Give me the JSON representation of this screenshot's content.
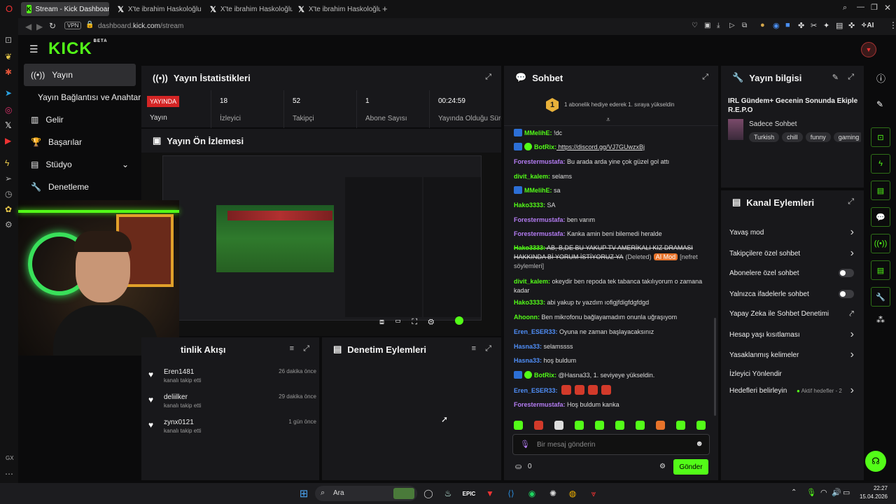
{
  "browser": {
    "tabs": [
      {
        "label": "Stream - Kick Dashboard",
        "active": true
      },
      {
        "label": "X'te ibrahim Haskoloğlu: \"",
        "active": false
      },
      {
        "label": "X'te ibrahim Haskoloğlu: \"",
        "active": false
      },
      {
        "label": "X'te ibrahim Haskoloğlu: \"",
        "active": false
      }
    ],
    "new_tab": "+",
    "vpn": "VPN",
    "url_host": "dashboard.",
    "url_bold": "kick.com",
    "url_path": "/stream",
    "ai_label": "AI",
    "sidebar_label": "GX"
  },
  "kick": {
    "logo": "KICK",
    "beta": "BETA",
    "nav": [
      {
        "label": "Yayın",
        "icon": "broadcast-icon",
        "active": true
      },
      {
        "label": "Yayın Bağlantısı ve Anahtarı",
        "icon": "",
        "active": false
      },
      {
        "label": "Gelir",
        "icon": "chart-icon",
        "active": false
      },
      {
        "label": "Başarılar",
        "icon": "trophy-icon",
        "active": false
      },
      {
        "label": "Stüdyo",
        "icon": "studio-icon",
        "active": false
      },
      {
        "label": "Denetleme",
        "icon": "wrench-icon",
        "active": false
      }
    ]
  },
  "stats": {
    "title": "Yayın İstatistikleri",
    "status_badge": "YAYINDA",
    "status_label": "Yayın",
    "items": [
      {
        "value": "18",
        "label": "İzleyici"
      },
      {
        "value": "52",
        "label": "Takipçi"
      },
      {
        "value": "1",
        "label": "Abone Sayısı"
      },
      {
        "value": "00:24:59",
        "label": "Yayında Olduğu Süre"
      }
    ]
  },
  "preview": {
    "title": "Yayın Ön İzlemesi"
  },
  "activity": {
    "title": "tinlik Akışı",
    "events": [
      {
        "name": "Eren1481",
        "sub": "kanalı takip etti",
        "time": "26 dakika önce"
      },
      {
        "name": "deliilker",
        "sub": "kanalı takip etti",
        "time": "29 dakika önce"
      },
      {
        "name": "zynx0121",
        "sub": "kanalı takip etti",
        "time": "1 gün önce"
      }
    ]
  },
  "modactions": {
    "title": "Denetim Eylemleri"
  },
  "chat": {
    "title": "Sohbet",
    "pinned_rank": "1",
    "pinned": "1 abonelik hediye ederek 1. sıraya yükseldin",
    "messages": [
      {
        "user": "MMelihE:",
        "color": "bot",
        "text": " !dc"
      },
      {
        "user": "BotRix:",
        "color": "bot",
        "text": " https://discord.gg/VJ7GUwzxBj"
      },
      {
        "user": "Forestermustafa:",
        "color": "purple",
        "text": " Bu arada arda yine çok güzel gol attı"
      },
      {
        "user": "divit_kalem:",
        "color": "green",
        "text": " selams"
      },
      {
        "user": "MMelihE:",
        "color": "bot",
        "text": " sa"
      },
      {
        "user": "Hako3333:",
        "color": "green",
        "text": " SA"
      },
      {
        "user": "Forestermustafa:",
        "color": "purple",
        "text": " ben varım"
      },
      {
        "user": "Forestermustafa:",
        "color": "purple",
        "text": " Kanka amin beni bilemedi heralde"
      },
      {
        "user": "Hako3333:",
        "color": "green",
        "text": " AB, B,DE BU YAKUP TV AMERİKALI KIZ DRAMASI HAKKINDA Bİ YORUM İSTİYORUZ YA"
      },
      {
        "user": "divit_kalem:",
        "color": "green",
        "text": " okeydir ben repoda tek tabanca takılıyorum o zamana kadar"
      },
      {
        "user": "Hako3333:",
        "color": "green",
        "text": " abi yakup tv yazdım ıofigjfdigfdgfdgd"
      },
      {
        "user": "Ahoonn:",
        "color": "green",
        "text": " Ben mikrofonu bağlayamadım onunla uğraşıyom"
      },
      {
        "user": "Eren_ESER33:",
        "color": "blue",
        "text": " Oyuna ne zaman başlayacaksınız"
      },
      {
        "user": "Hasna33:",
        "color": "blue",
        "text": " selamssss"
      },
      {
        "user": "Hasna33:",
        "color": "blue",
        "text": " hoş buldum"
      },
      {
        "user": "BotRix:",
        "color": "bot",
        "text": " @Hasna33, 1. seviyeye yükseldin."
      },
      {
        "user": "Eren_ESER33:",
        "color": "blue",
        "text": ""
      },
      {
        "user": "Forestermustafa:",
        "color": "purple",
        "text": " Hoş buldum kanka"
      }
    ],
    "deleted": "(Deleted)",
    "ai_mod": "AI Mod",
    "reason": "[nefret söylemleri]",
    "placeholder": "Bir mesaj gönderin",
    "points": "0",
    "send": "Gönder"
  },
  "streaminfo": {
    "title": "Yayın bilgisi",
    "stream_title": "IRL Gündem+ Gecenin Sonunda Ekiple R.E.P.O",
    "category": "Sadece Sohbet",
    "tags": [
      "Turkish",
      "chill",
      "funny",
      "gaming"
    ]
  },
  "channelactions": {
    "title": "Kanal Eylemleri",
    "items": [
      {
        "label": "Yavaş mod",
        "control": "chevron"
      },
      {
        "label": "Takipçilere özel sohbet",
        "control": "chevron"
      },
      {
        "label": "Abonelere özel sohbet",
        "control": "toggle"
      },
      {
        "label": "Yalnızca ifadelerle sohbet",
        "control": "toggle"
      },
      {
        "label": "Yapay Zeka ile Sohbet Denetimi",
        "control": "external"
      },
      {
        "label": "Hesap yaşı kısıtlaması",
        "control": "chevron"
      },
      {
        "label": "Yasaklanmış kelimeler",
        "control": "chevron"
      },
      {
        "label": "İzleyici Yönlendir",
        "control": "none"
      },
      {
        "label": "Hedefleri belirleyin",
        "control": "chevron"
      }
    ],
    "goals_status": "Aktif hedefler - 2"
  },
  "taskbar": {
    "search": "Ara",
    "time": "22:27",
    "date": "15.04.2026"
  },
  "colors": {
    "accent": "#53fc18",
    "panel": "#18181b",
    "bg": "#0b0b0c"
  }
}
